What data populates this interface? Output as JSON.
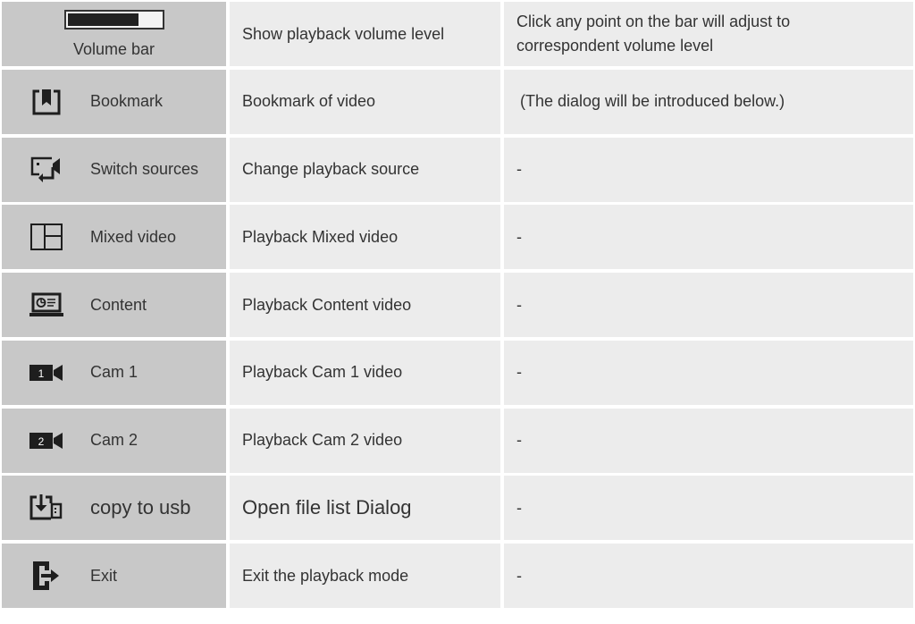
{
  "rows": [
    {
      "label": "Volume bar",
      "description": "Show playback volume level",
      "note": "Click any point on the bar will adjust to correspondent volume level",
      "icon": "volume-bar-icon"
    },
    {
      "label": "Bookmark",
      "description": "Bookmark of video",
      "note": "(The dialog will be introduced below.)",
      "icon": "bookmark-icon"
    },
    {
      "label": "Switch sources",
      "description": "Change playback source",
      "note": "-",
      "icon": "switch-sources-icon"
    },
    {
      "label": "Mixed video",
      "description": "Playback Mixed video",
      "note": "-",
      "icon": "mixed-video-icon"
    },
    {
      "label": "Content",
      "description": "Playback Content video",
      "note": "-",
      "icon": "content-icon"
    },
    {
      "label": "Cam 1",
      "description": "Playback Cam 1 video",
      "note": "-",
      "icon": "cam-1-icon",
      "icon_text": "1"
    },
    {
      "label": "Cam 2",
      "description": "Playback Cam 2 video",
      "note": "-",
      "icon": "cam-2-icon",
      "icon_text": "2"
    },
    {
      "label": "copy to usb",
      "description": "Open file list Dialog",
      "note": "-",
      "icon": "copy-to-usb-icon"
    },
    {
      "label": "Exit",
      "description": "Exit the playback mode",
      "note": "-",
      "icon": "exit-icon"
    }
  ],
  "volume_level": 0.76,
  "colors": {
    "icon_column_bg": "#c8c8c8",
    "cell_bg": "#ececec",
    "text": "#333333",
    "icon": "#1e1e1e"
  }
}
